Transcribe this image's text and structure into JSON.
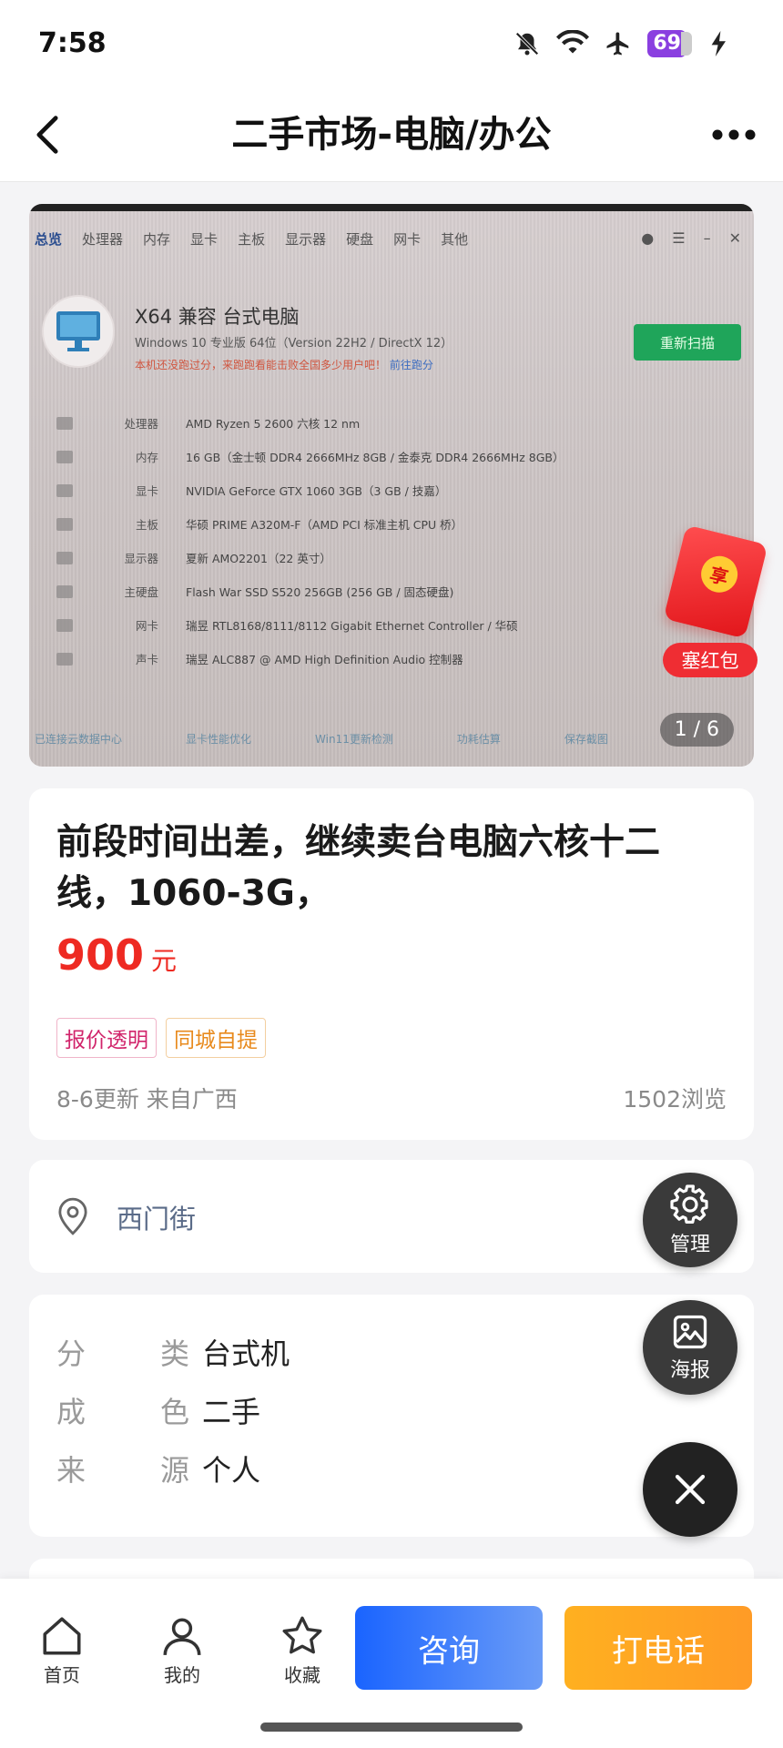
{
  "status_bar": {
    "time": "7:58",
    "battery": "69"
  },
  "header": {
    "title": "二手市场-电脑/办公"
  },
  "photo": {
    "counter": "1 / 6",
    "nav_tabs": [
      "总览",
      "处理器",
      "内存",
      "显卡",
      "主板",
      "显示器",
      "硬盘",
      "网卡",
      "其他"
    ],
    "heading": "X64 兼容 台式电脑",
    "os": "Windows 10 专业版 64位（Version 22H2 / DirectX 12）",
    "notice": "本机还没跑过分，来跑跑看能击败全国多少用户吧！",
    "notice_link": "前往跑分",
    "rescan": "重新扫描",
    "rows": [
      {
        "k": "处理器",
        "v": "AMD Ryzen 5 2600 六核   12 nm"
      },
      {
        "k": "内存",
        "v": "16 GB（金士顿 DDR4 2666MHz 8GB / 金泰克 DDR4 2666MHz 8GB）"
      },
      {
        "k": "显卡",
        "v": "NVIDIA GeForce GTX 1060 3GB（3 GB / 技嘉）"
      },
      {
        "k": "主板",
        "v": "华硕 PRIME A320M-F（AMD PCI 标准主机 CPU 桥）"
      },
      {
        "k": "显示器",
        "v": "夏新 AMO2201（22 英寸）"
      },
      {
        "k": "主硬盘",
        "v": "Flash War SSD S520 256GB (256 GB / 固态硬盘)"
      },
      {
        "k": "网卡",
        "v": "瑞昱 RTL8168/8111/8112 Gigabit Ethernet Controller / 华硕"
      },
      {
        "k": "声卡",
        "v": "瑞昱 ALC887 @ AMD High Definition Audio 控制器"
      }
    ],
    "footer": [
      "已连接云数据中心",
      "显卡性能优化",
      "Win11更新检测",
      "功耗估算",
      "保存截图"
    ]
  },
  "red_envelope": {
    "seal": "享",
    "label": "塞红包"
  },
  "listing": {
    "title": "前段时间出差，继续卖台电脑六核十二线，1060-3G，",
    "price": "900",
    "price_unit": "元",
    "tags": [
      "报价透明",
      "同城自提"
    ],
    "updated": "8-6更新 来自广西",
    "views": "1502浏览"
  },
  "location": {
    "text": "西门街"
  },
  "attributes": [
    {
      "k1": "分",
      "k2": "类",
      "v": "台式机"
    },
    {
      "k1": "成",
      "k2": "色",
      "v": "二手"
    },
    {
      "k1": "来",
      "k2": "源",
      "v": "个人"
    }
  ],
  "fabs": {
    "manage": "管理",
    "poster": "海报"
  },
  "bottom_nav": {
    "home": "首页",
    "mine": "我的",
    "favorite": "收藏",
    "consult": "咨询",
    "call": "打电话"
  }
}
